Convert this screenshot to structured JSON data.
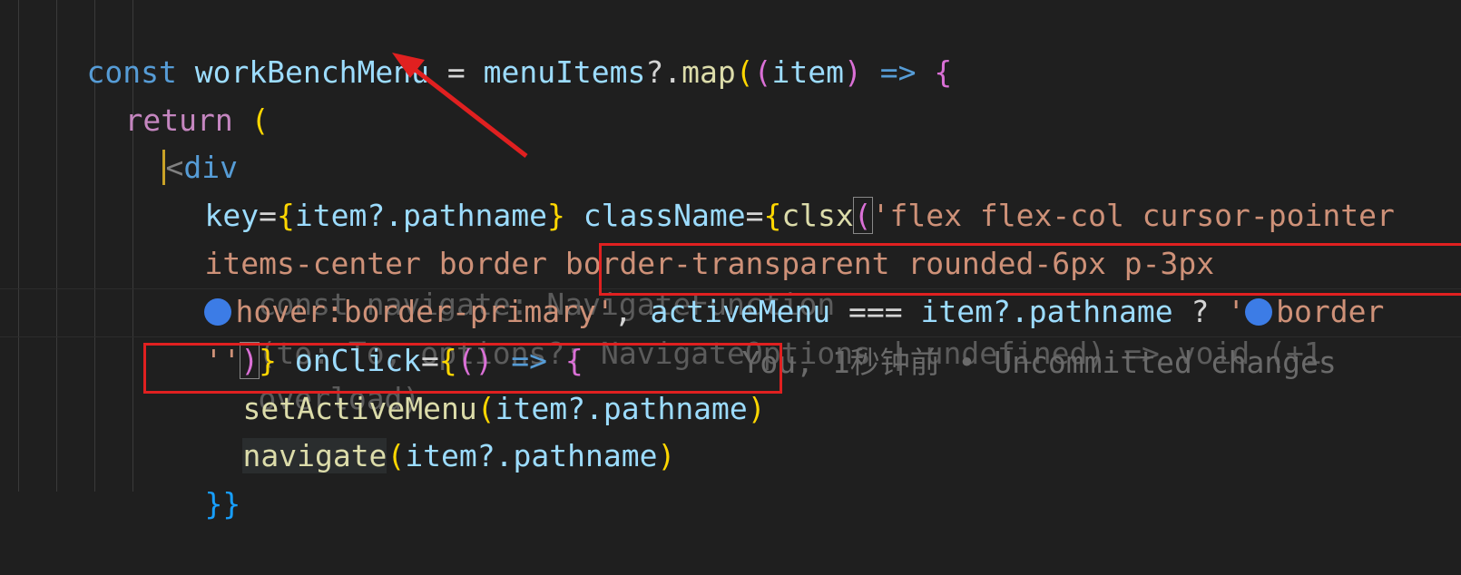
{
  "code": {
    "line1": {
      "kw": "const",
      "var": "workBenchMenu",
      "eq": " = ",
      "obj": "menuItems",
      "opt": "?.",
      "fn": "map",
      "p1": "(",
      "p2": "(",
      "param": "item",
      "p3": ")",
      "arrow": " => ",
      "brace": "{"
    },
    "line2": {
      "kw": "return",
      "paren": "("
    },
    "line3": {
      "lt": "<",
      "tag": "div"
    },
    "line4": {
      "attr": "key",
      "eq": "=",
      "b": "{",
      "val": "item?.pathname",
      "b2": "}",
      "attr2": "className",
      "eq2": "=",
      "b3": "{",
      "fn": "clsx",
      "p": "(",
      "str": "'flex flex-col cursor-pointer"
    },
    "line5": {
      "str": "items-center border border-transparent rounded-6px p-3px"
    },
    "line6": {
      "str1": "hover:border-primary'",
      "comma": ", ",
      "var": "activeMenu",
      "cmp": " === ",
      "val": "item?.pathname",
      "q": " ? ",
      "str2": "'",
      "str3": "border"
    },
    "line6_ghost": "const navigate: NavigateFunction",
    "line7": {
      "str": "''",
      "p": ")",
      "b": "}",
      "attr": "onClick",
      "eq": "=",
      "b2": "{",
      "p2": "()",
      "arrow": " => ",
      "b3": "{"
    },
    "line7_ghost": "(to: To, options?: NavigateOptions | undefined) => void (+1",
    "line7_blame": "You, 1秒钟前 • Uncommitted changes",
    "line8_ghost": "overload)",
    "line8": {
      "fn": "setActiveMenu",
      "p": "(",
      "arg": "item?.pathname",
      "p2": ")"
    },
    "line9": {
      "fn": "navigate",
      "p": "(",
      "arg": "item?.pathname",
      "p2": ")"
    },
    "line10": {
      "b": "}}"
    }
  },
  "colors": {
    "background": "#1f1f1f",
    "highlight": "#e02020",
    "arrow": "#e02020"
  },
  "icons": [
    "color-swatch-icon",
    "arrow-annotation-icon"
  ]
}
